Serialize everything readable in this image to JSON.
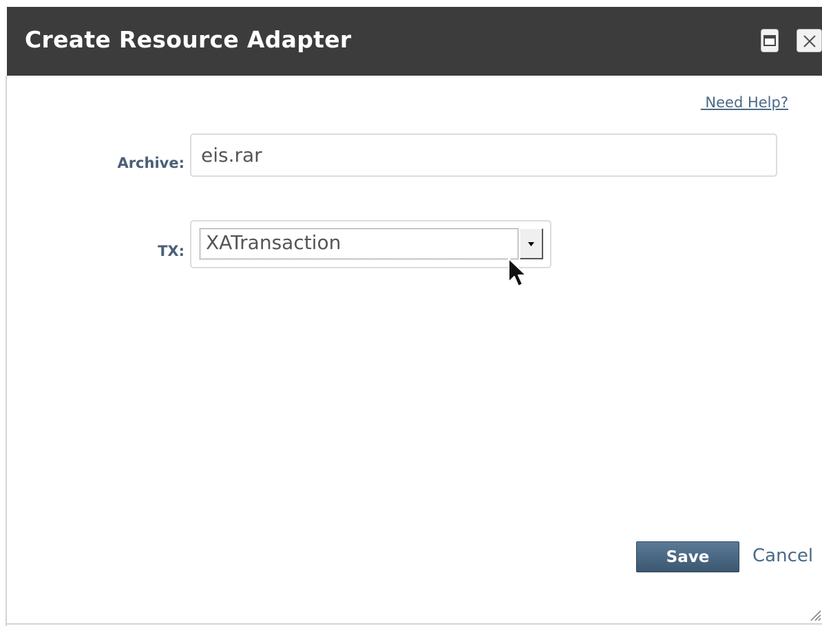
{
  "dialog": {
    "title": "Create Resource Adapter",
    "maximize_icon": "maximize-icon",
    "close_icon": "close-icon"
  },
  "help": {
    "label": " Need Help?"
  },
  "form": {
    "archive_label": "Archive:",
    "archive_value": "eis.rar",
    "tx_label": "TX:",
    "tx_selected": "XATransaction",
    "tx_arrow_icon": "chevron-down-icon"
  },
  "actions": {
    "save_label": "Save",
    "cancel_label": "Cancel"
  },
  "colors": {
    "titlebar": "#3c3c3c",
    "label": "#4a5f78",
    "link": "#4a6a86",
    "save_button": "#4a6882"
  }
}
